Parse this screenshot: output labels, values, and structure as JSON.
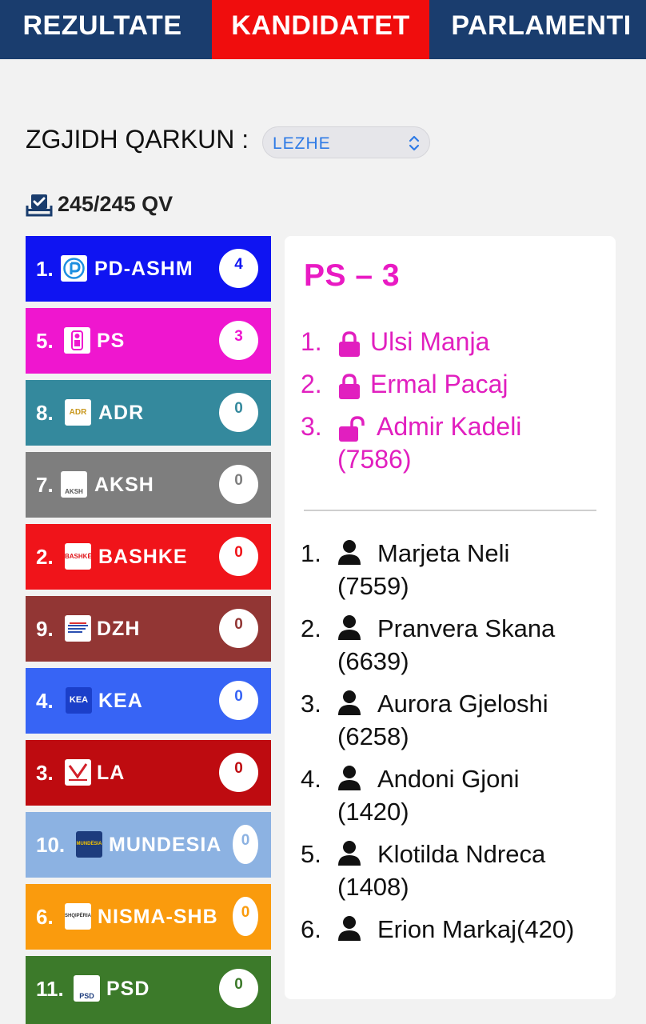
{
  "nav": {
    "tabs": [
      {
        "label": "REZULTATE"
      },
      {
        "label": "KANDIDATET",
        "active": true
      },
      {
        "label": "PARLAMENTI"
      }
    ]
  },
  "region": {
    "label": "ZGJIDH QARKUN :",
    "selected": "LEZHE"
  },
  "polling": {
    "icon": "ballot-box-check-icon",
    "counted": "245/245 QV"
  },
  "parties": [
    {
      "number": "1.",
      "name": "PD-ASHM",
      "seats": "4",
      "color": "#0f14f2",
      "logo": "pd-logo"
    },
    {
      "number": "5.",
      "name": "PS",
      "seats": "3",
      "color": "#ef16cf",
      "logo": "ps-logo"
    },
    {
      "number": "8.",
      "name": "ADR",
      "seats": "0",
      "color": "#34899d",
      "logo": "adr-logo",
      "logo_text": "ADR"
    },
    {
      "number": "7.",
      "name": "AKSH",
      "seats": "0",
      "color": "#7e7e7e",
      "logo": "aksh-logo",
      "logo_text": "AKSH"
    },
    {
      "number": "2.",
      "name": "BASHKE",
      "seats": "0",
      "color": "#f0141a",
      "logo": "bashke-logo",
      "logo_text": "BASHKË"
    },
    {
      "number": "9.",
      "name": "DZH",
      "seats": "0",
      "color": "#923634",
      "logo": "dzh-logo"
    },
    {
      "number": "4.",
      "name": "KEA",
      "seats": "0",
      "color": "#3764f5",
      "logo": "kea-logo",
      "logo_text": "KEA"
    },
    {
      "number": "3.",
      "name": "LA",
      "seats": "0",
      "color": "#be0b10",
      "logo": "la-logo"
    },
    {
      "number": "10.",
      "name": "MUNDESIA",
      "seats": "0",
      "color": "#8cb2e2",
      "logo": "mundesia-logo",
      "logo_text": "MUNDËSIA"
    },
    {
      "number": "6.",
      "name": "NISMA-SHB",
      "seats": "0",
      "color": "#fa9b0d",
      "logo": "nisma-logo",
      "logo_text": "SHQIPËRIA"
    },
    {
      "number": "11.",
      "name": "PSD",
      "seats": "0",
      "color": "#3c7a2a",
      "logo": "psd-logo",
      "logo_text": "PSD"
    }
  ],
  "detail": {
    "title": "PS – 3",
    "elected": [
      {
        "number": "1.",
        "name": "Ulsi Manja",
        "lock": "lock-closed-icon"
      },
      {
        "number": "2.",
        "name": "Ermal Pacaj",
        "lock": "lock-closed-icon"
      },
      {
        "number": "3.",
        "name": "Admir Kadeli",
        "votes": "(7586)",
        "lock": "lock-open-icon"
      }
    ],
    "candidates": [
      {
        "number": "1.",
        "name": "Marjeta Neli",
        "votes": "(7559)"
      },
      {
        "number": "2.",
        "name": "Pranvera Skana",
        "votes": "(6639)"
      },
      {
        "number": "3.",
        "name": "Aurora Gjeloshi",
        "votes": "(6258)"
      },
      {
        "number": "4.",
        "name": "Andoni Gjoni",
        "votes": "(1420)"
      },
      {
        "number": "5.",
        "name": "Klotilda Ndreca",
        "votes": "(1408)"
      },
      {
        "number": "6.",
        "name": "Erion Markaj",
        "votes": "(420)"
      }
    ]
  }
}
